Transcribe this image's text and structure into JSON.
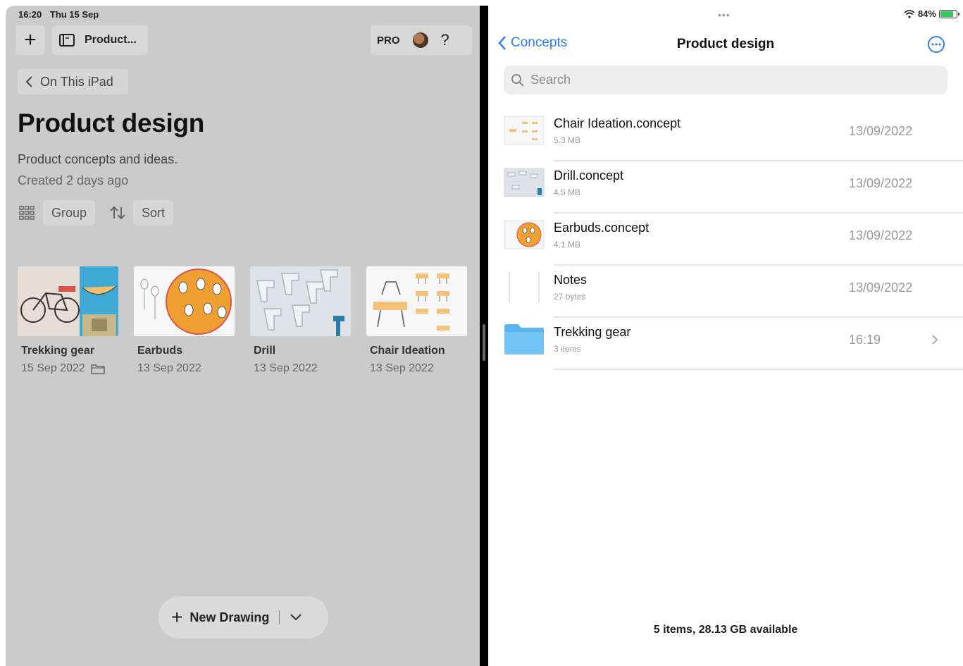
{
  "left_status": {
    "time": "16:20",
    "date": "Thu 15 Sep"
  },
  "left_toolbar": {
    "title": "Product...",
    "pro": "PRO",
    "help": "?"
  },
  "back": {
    "label": "On This iPad"
  },
  "project": {
    "title": "Product design",
    "description": "Product concepts and ideas.",
    "created": "Created 2 days ago"
  },
  "controls": {
    "group": "Group",
    "sort": "Sort"
  },
  "cards": [
    {
      "name": "Trekking gear",
      "date": "15 Sep 2022",
      "is_folder": true
    },
    {
      "name": "Earbuds",
      "date": "13 Sep 2022"
    },
    {
      "name": "Drill",
      "date": "13 Sep 2022"
    },
    {
      "name": "Chair Ideation",
      "date": "13 Sep 2022"
    }
  ],
  "new_drawing": {
    "label": "New Drawing"
  },
  "right_status": {
    "battery": "84%"
  },
  "files_nav": {
    "back": "Concepts",
    "title": "Product design"
  },
  "search": {
    "placeholder": "Search",
    "value": ""
  },
  "files": [
    {
      "name": "Chair Ideation.concept",
      "size": "5.3 MB",
      "date": "13/09/2022"
    },
    {
      "name": "Drill.concept",
      "size": "4.5 MB",
      "date": "13/09/2022"
    },
    {
      "name": "Earbuds.concept",
      "size": "4.1 MB",
      "date": "13/09/2022"
    },
    {
      "name": "Notes",
      "size": "27 bytes",
      "date": "13/09/2022"
    },
    {
      "name": "Trekking gear",
      "size": "3 items",
      "date": "16:19"
    }
  ],
  "footer": "5 items, 28.13 GB available",
  "colors": {
    "accent": "#2f7cf6",
    "folder": "#5ab4f0",
    "left_bg": "#cbcbcb",
    "orange": "#f0a030"
  }
}
